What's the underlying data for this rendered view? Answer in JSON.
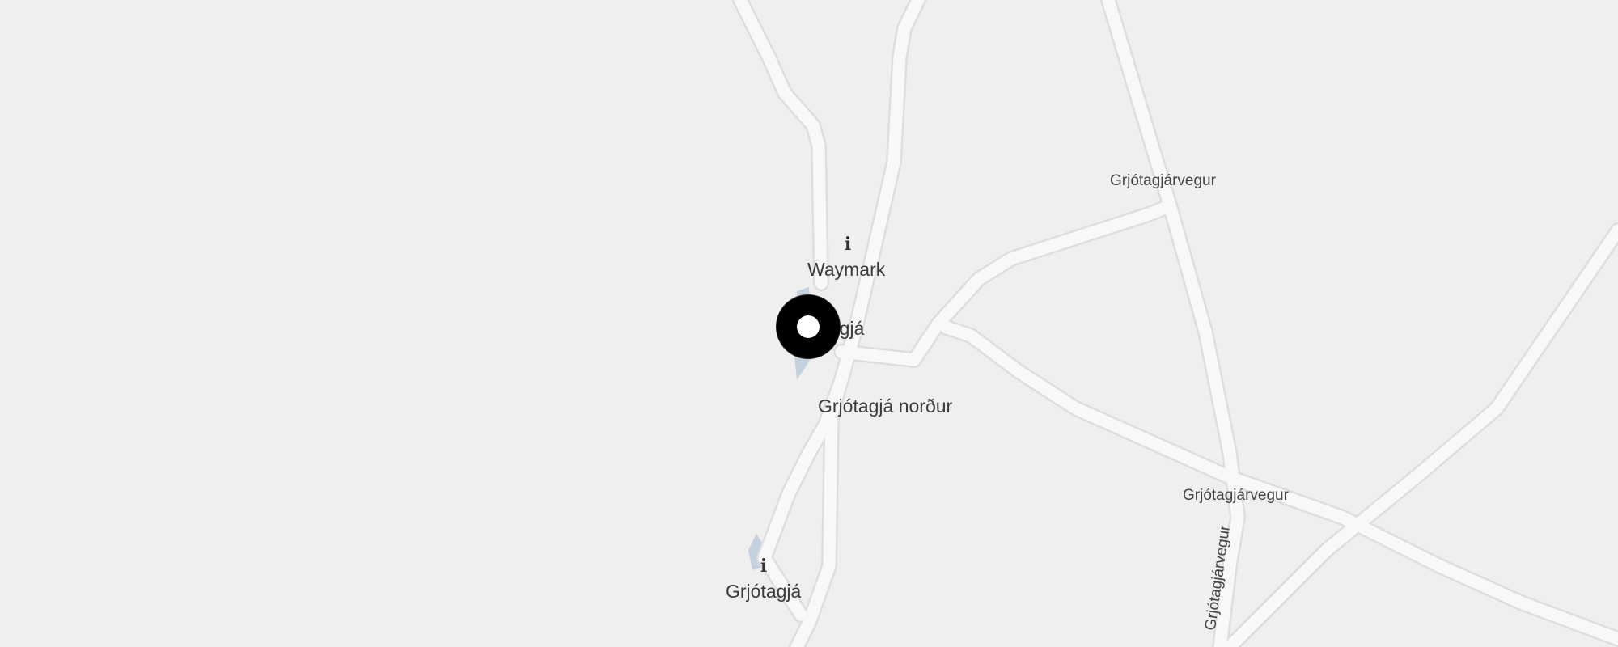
{
  "map": {
    "colors": {
      "background": "#efefef",
      "road": "#f8f8f8",
      "road_edge": "#dcdfdd",
      "water": "#b9cbdc",
      "text": "#3b3b3b",
      "marker": "#000000"
    },
    "pois": [
      {
        "name": "Waymark",
        "icon": "info-icon"
      },
      {
        "name": "Grjótagjá norður",
        "icon": null
      },
      {
        "name": "Grjótagjá",
        "icon": "info-icon"
      },
      {
        "name": "Grjótagjá",
        "icon": null,
        "partially_hidden": true
      }
    ],
    "roads": {
      "label_1": "Grjótagjárvegur",
      "label_2": "Grjótagjárvegur",
      "label_3": "Grjótagjárvegur"
    },
    "marker": {
      "icon": "location-ring-marker"
    }
  }
}
